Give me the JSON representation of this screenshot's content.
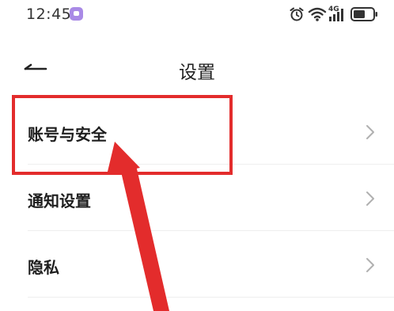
{
  "status_bar": {
    "time": "12:45",
    "network_label": "4G"
  },
  "header": {
    "title": "设置"
  },
  "settings": {
    "items": [
      {
        "label": "账号与安全"
      },
      {
        "label": "通知设置"
      },
      {
        "label": "隐私"
      }
    ]
  },
  "annotation": {
    "color": "#e32c2c",
    "highlight_target": "账号与安全"
  },
  "icons": {
    "back": "back-arrow-icon",
    "chevron": "chevron-right-icon",
    "alarm": "alarm-icon",
    "wifi": "wifi-icon",
    "signal": "signal-icon",
    "battery": "battery-icon"
  }
}
